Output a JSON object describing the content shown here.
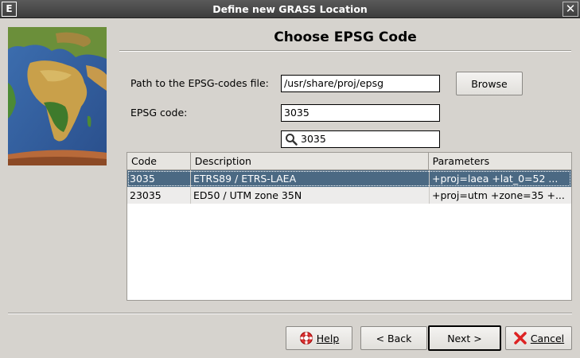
{
  "window": {
    "title": "Define new GRASS Location",
    "app_icon_letter": "E",
    "close_glyph": "✕"
  },
  "page": {
    "heading": "Choose EPSG Code"
  },
  "form": {
    "path_label": "Path to the EPSG-codes file:",
    "path_value": "/usr/share/proj/epsg",
    "browse_label": "Browse",
    "epsg_label": "EPSG code:",
    "epsg_value": "3035",
    "search_value": "3035"
  },
  "table": {
    "columns": [
      "Code",
      "Description",
      "Parameters"
    ],
    "rows": [
      {
        "code": "3035",
        "description": "ETRS89 / ETRS-LAEA",
        "parameters": "+proj=laea +lat_0=52 ...",
        "selected": true
      },
      {
        "code": "23035",
        "description": "ED50 / UTM zone 35N",
        "parameters": "+proj=utm +zone=35 +...",
        "selected": false
      }
    ]
  },
  "buttons": {
    "help": "Help",
    "back": "< Back",
    "next": "Next >",
    "cancel": "Cancel"
  },
  "colors": {
    "selection": "#4b6983",
    "titlebar": "#4a4a4a",
    "dialog_bg": "#d6d3ce"
  }
}
